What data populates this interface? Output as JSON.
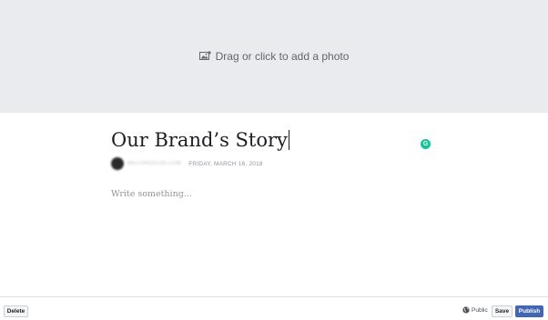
{
  "cover": {
    "prompt": "Drag or click to add a photo",
    "icon": "photo-icon"
  },
  "article": {
    "title": "Our Brand’s Story",
    "author": "MECANOGUN.COM",
    "date": "FRIDAY, MARCH 16, 2018",
    "body_placeholder": "Write something..."
  },
  "footer": {
    "delete_label": "Delete",
    "privacy_label": "Public",
    "privacy_icon": "globe-icon",
    "save_label": "Save",
    "publish_label": "Publish"
  },
  "colors": {
    "cover_bg": "#e9ebee",
    "publish_bg": "#4267b2",
    "grammarly": "#15c39a"
  }
}
